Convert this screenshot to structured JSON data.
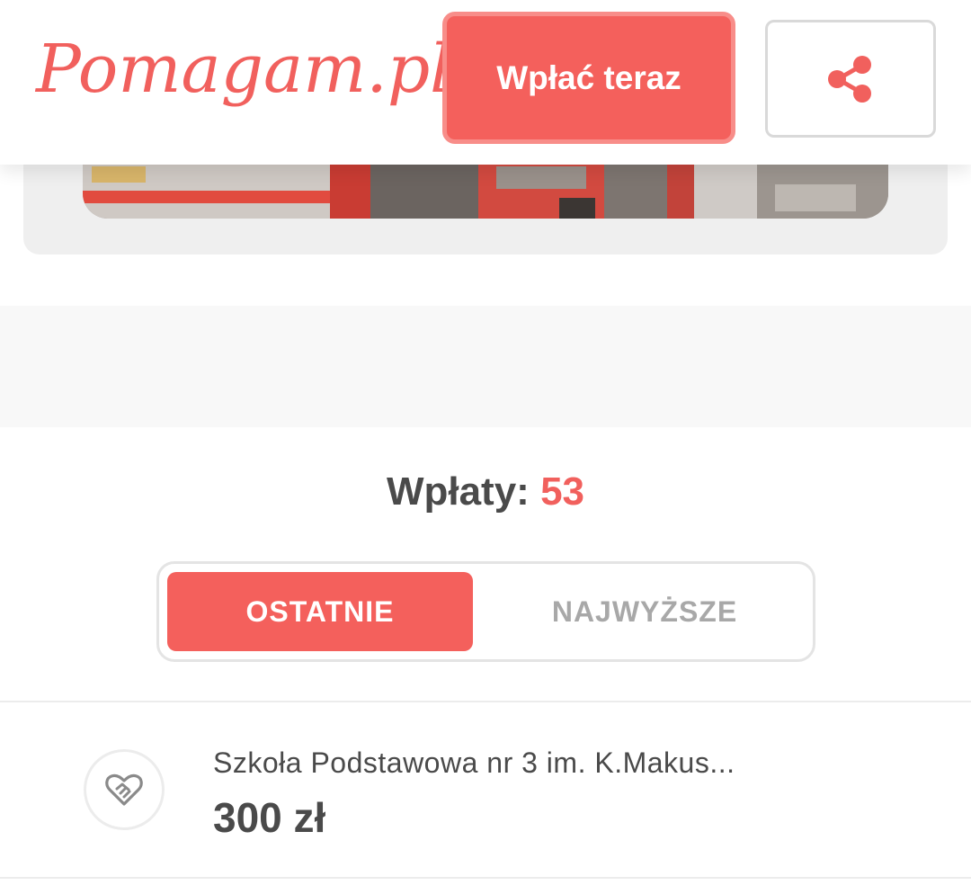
{
  "header": {
    "logo_text": "Pomagam.pl",
    "donate_label": "Wpłać teraz",
    "share_icon": "share-icon"
  },
  "colors": {
    "brand": "#f1605d",
    "button": "#f4605c",
    "text": "#4a4a4a",
    "muted": "#a8a8a8"
  },
  "payments": {
    "label": "Wpłaty:",
    "count": "53"
  },
  "tabs": [
    {
      "label": "OSTATNIE",
      "active": true
    },
    {
      "label": "NAJWYŻSZE",
      "active": false
    }
  ],
  "donations": [
    {
      "icon": "heart-handshake-icon",
      "name": "Szkoła Podstawowa nr 3 im. K.Makus...",
      "amount": "300 zł"
    }
  ]
}
